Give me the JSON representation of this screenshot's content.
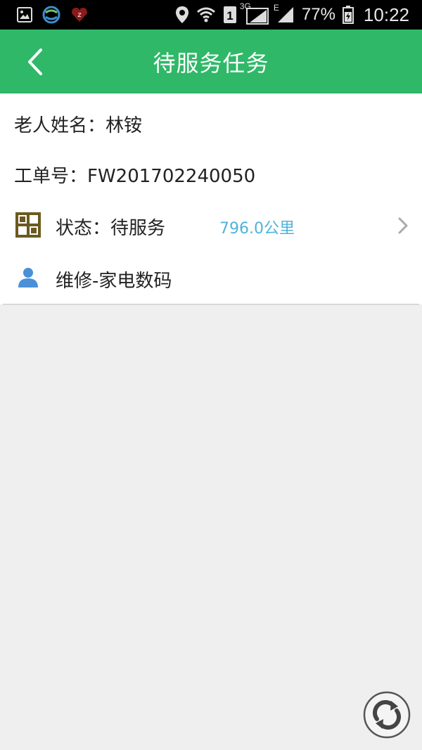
{
  "status_bar": {
    "battery_percent": "77%",
    "time": "10:22",
    "network_type": "3G",
    "edge_label": "E",
    "sim_label": "1",
    "icons": [
      "gallery-icon",
      "china-mobile-icon",
      "z-app-icon",
      "location-icon",
      "wifi-icon",
      "signal-icon",
      "battery-icon"
    ]
  },
  "header": {
    "title": "待服务任务",
    "back_icon": "chevron-left-icon"
  },
  "task": {
    "elder_name": "老人姓名：林铵",
    "order_no": "工单号：FW201702240050",
    "status": "状态：待服务",
    "distance": "796.0公里",
    "service_type": "维修-家电数码"
  },
  "colors": {
    "header_bg": "#2fb868",
    "distance_text": "#4fb3d9",
    "status_icon": "#6b5a1f",
    "user_icon": "#4a90d9",
    "page_bg": "#efefef"
  }
}
